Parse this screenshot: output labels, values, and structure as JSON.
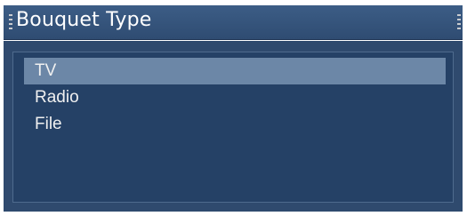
{
  "dialog": {
    "title": "Bouquet Type"
  },
  "bouquet_list": {
    "items": [
      {
        "label": "TV",
        "selected": true
      },
      {
        "label": "Radio",
        "selected": false
      },
      {
        "label": "File",
        "selected": false
      }
    ]
  }
}
